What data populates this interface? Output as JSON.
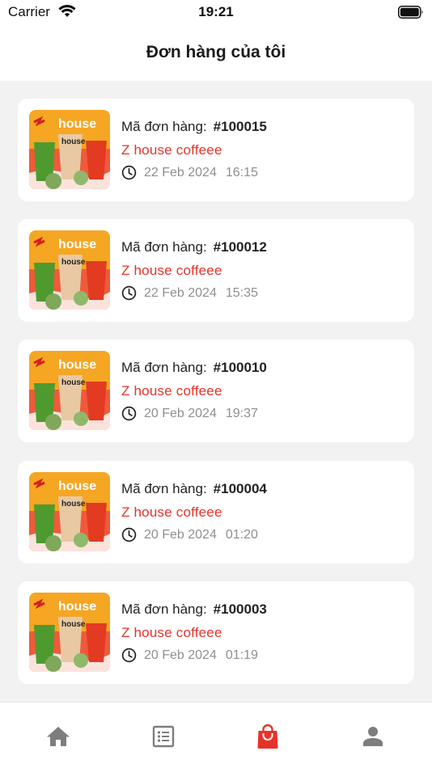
{
  "status_bar": {
    "carrier": "Carrier",
    "time": "19:21"
  },
  "header": {
    "title": "Đơn hàng của tôi"
  },
  "order_label": "Mã đơn hàng:",
  "orders": [
    {
      "number": "#100015",
      "store": "Z house coffeee",
      "date": "22 Feb 2024",
      "time": "16:15"
    },
    {
      "number": "#100012",
      "store": "Z house coffeee",
      "date": "22 Feb 2024",
      "time": "15:35"
    },
    {
      "number": "#100010",
      "store": "Z house coffeee",
      "date": "20 Feb 2024",
      "time": "19:37"
    },
    {
      "number": "#100004",
      "store": "Z house coffeee",
      "date": "20 Feb 2024",
      "time": "01:20"
    },
    {
      "number": "#100003",
      "store": "Z house coffeee",
      "date": "20 Feb 2024",
      "time": "01:19"
    }
  ],
  "thumbnail": {
    "logo_text": "house",
    "cup_text": "house"
  },
  "tabs": [
    {
      "icon": "home-icon",
      "active": false
    },
    {
      "icon": "list-icon",
      "active": false
    },
    {
      "icon": "shopping-bag-icon",
      "active": true
    },
    {
      "icon": "user-icon",
      "active": false
    }
  ],
  "colors": {
    "accent": "#e5332a",
    "inactive_tab": "#7d7d7d",
    "background": "#f2f2f2"
  }
}
